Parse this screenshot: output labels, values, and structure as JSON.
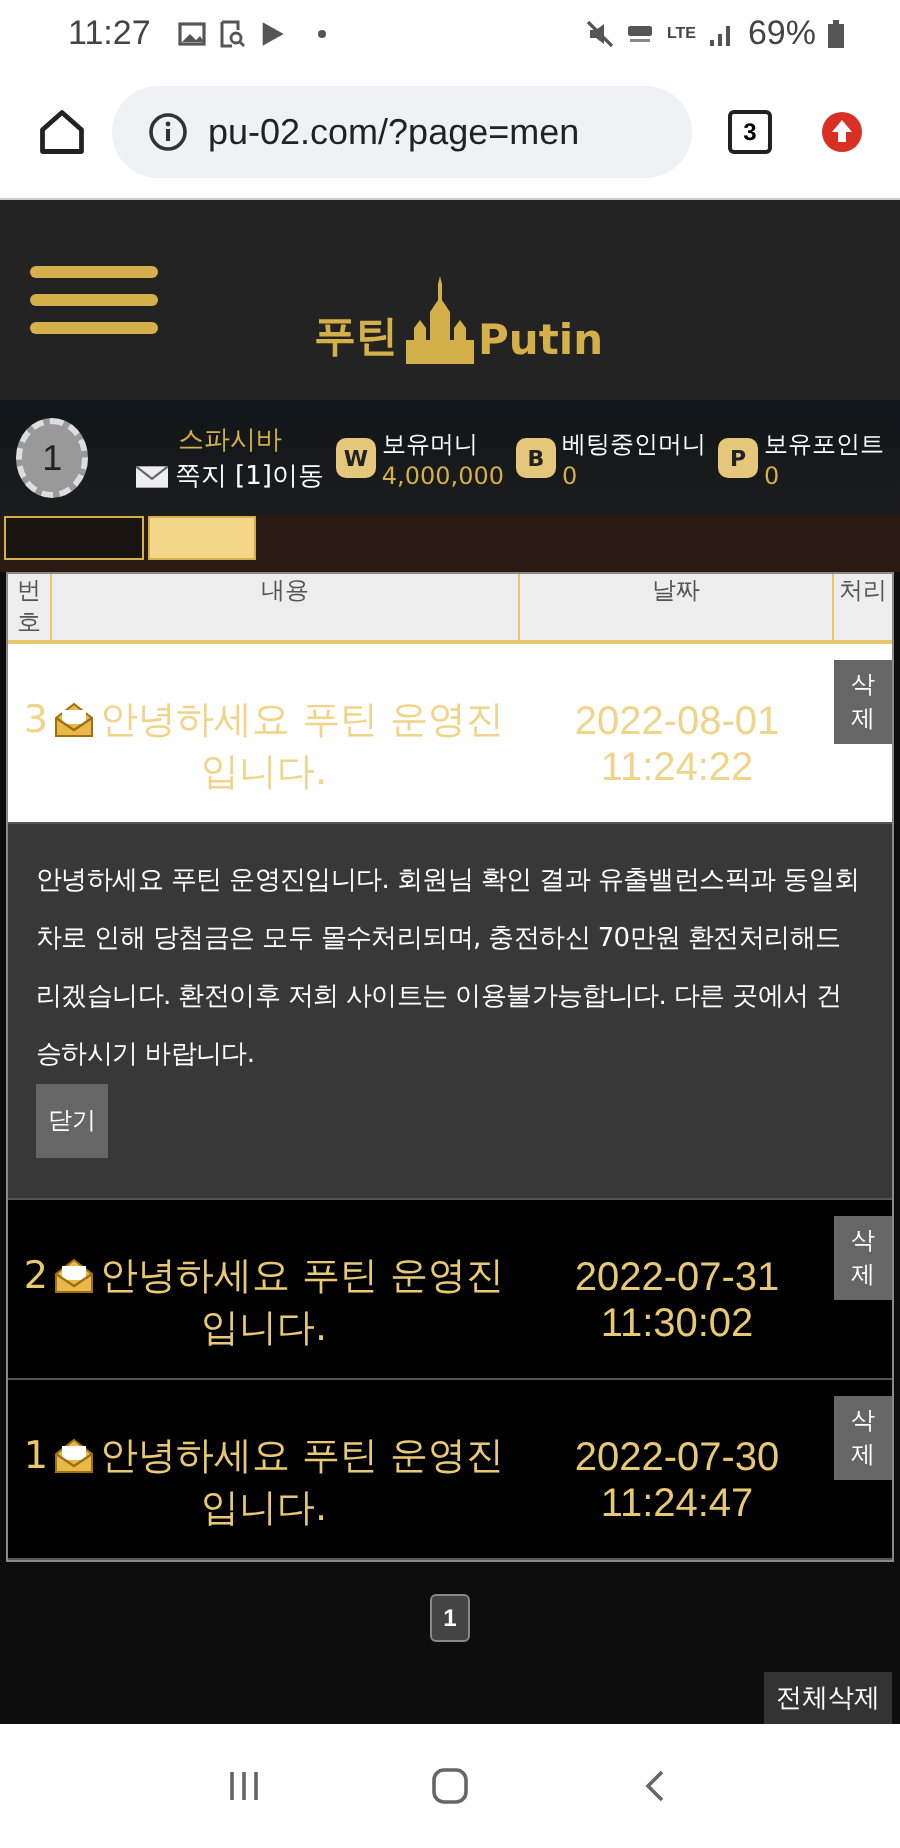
{
  "status_bar": {
    "time": "11:27",
    "network": "LTE",
    "battery": "69%"
  },
  "browser": {
    "url": "pu-02.com/?page=men",
    "tab_count": "3"
  },
  "header": {
    "logo_korean": "푸틴",
    "logo_latin": "Putin"
  },
  "user": {
    "level": "1",
    "name": "스파시바",
    "messages": "쪽지 [1]이동",
    "wallets": [
      {
        "badge": "W",
        "label": "보유머니",
        "value": "4,000,000"
      },
      {
        "badge": "B",
        "label": "베팅중인머니",
        "value": "0"
      },
      {
        "badge": "P",
        "label": "보유포인트",
        "value": "0"
      }
    ]
  },
  "table": {
    "columns": [
      "번호",
      "내용",
      "날짜",
      "처리"
    ],
    "rows": [
      {
        "number": "3",
        "title": "안녕하세요 푸틴 운영진입니다.",
        "date": "2022-08-01",
        "time": "11:24:22",
        "action": "삭제",
        "expanded": true,
        "message": "안녕하세요 푸틴 운영진입니다. 회원님 확인 결과 유출밸런스픽과 동일회차로 인해 당첨금은 모두 몰수처리되며, 충전하신 70만원 환전처리해드리겠습니다. 환전이후 저희 사이트는 이용불가능합니다. 다른 곳에서 건승하시기 바랍니다.",
        "close": "닫기"
      },
      {
        "number": "2",
        "title": "안녕하세요 푸틴 운영진입니다.",
        "date": "2022-07-31",
        "time": "11:30:02",
        "action": "삭제",
        "expanded": false
      },
      {
        "number": "1",
        "title": "안녕하세요 푸틴 운영진입니다.",
        "date": "2022-07-30",
        "time": "11:24:47",
        "action": "삭제",
        "expanded": false
      }
    ]
  },
  "pagination": [
    {
      "label": "1",
      "selected": true
    }
  ],
  "delete_all": "전체삭제"
}
